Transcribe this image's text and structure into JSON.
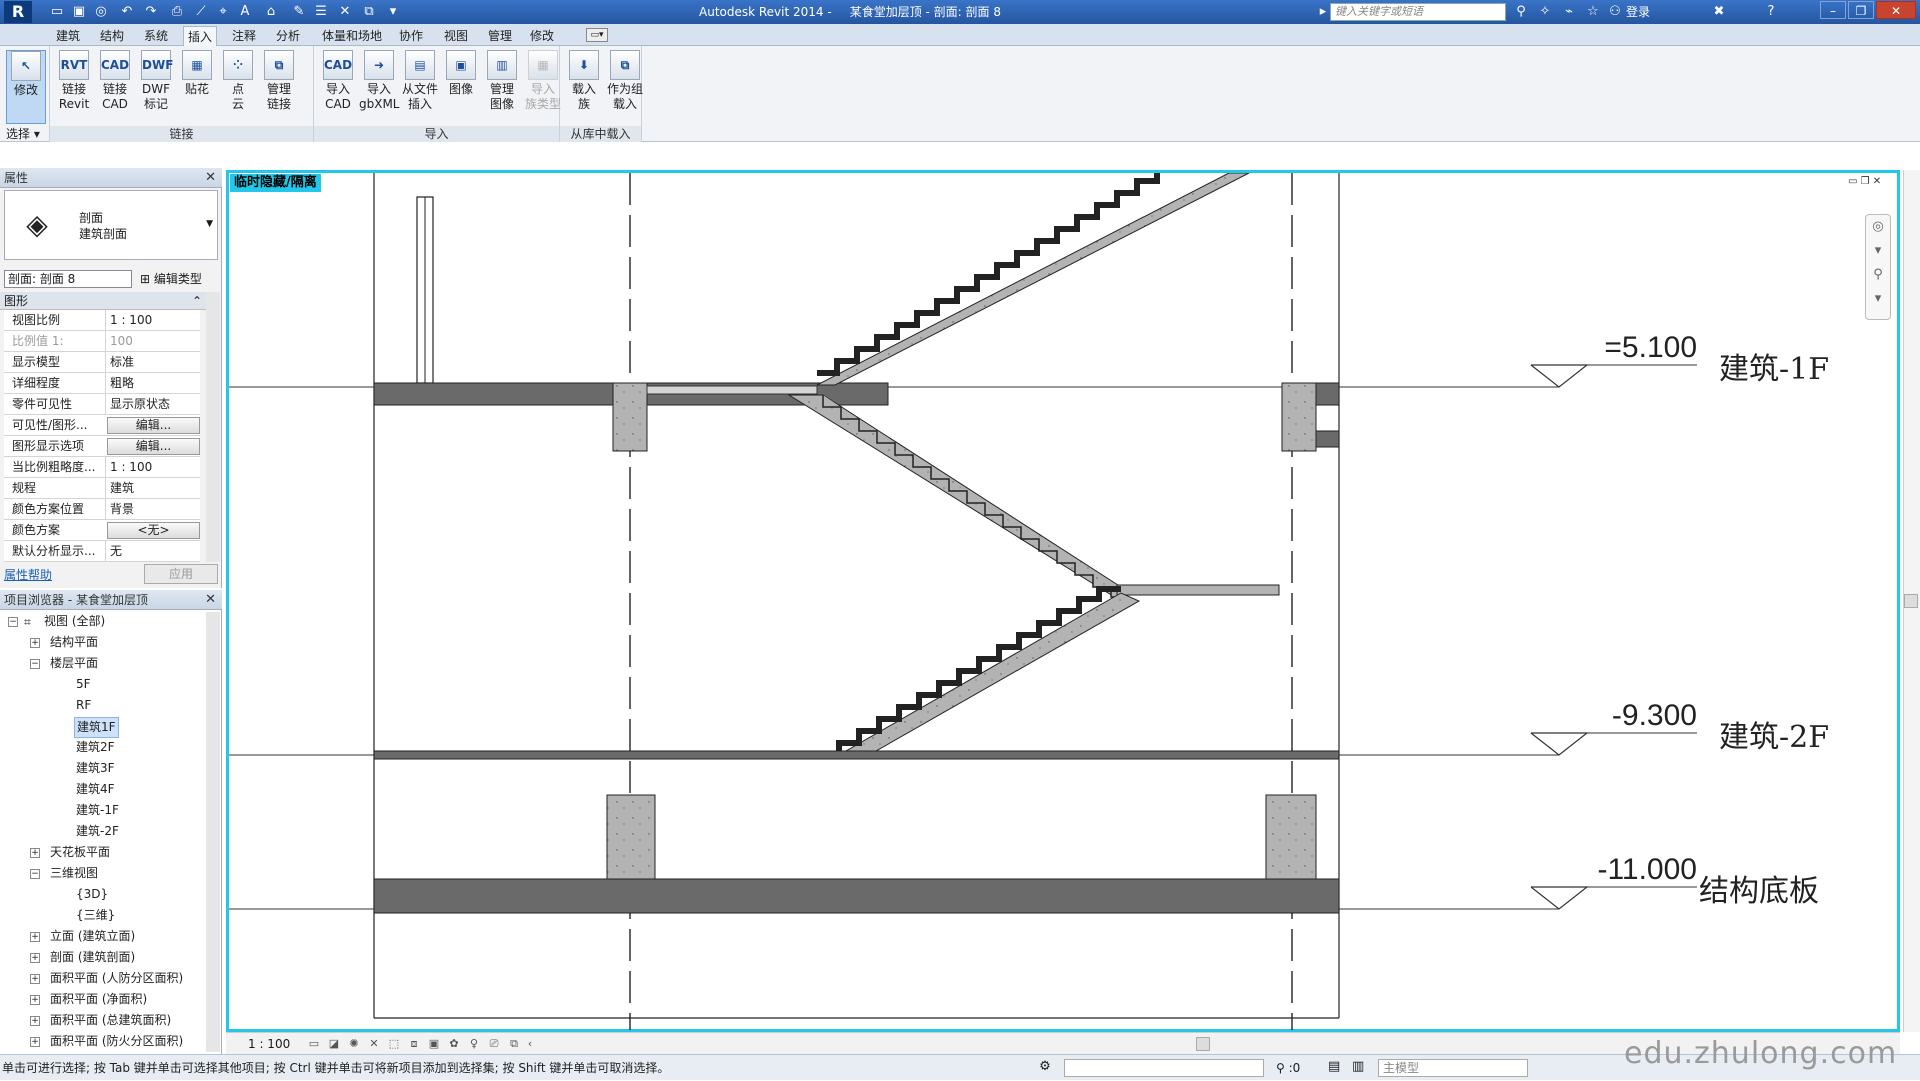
{
  "titlebar": {
    "app_name": "Autodesk Revit 2014 -",
    "doc_title": "某食堂加层顶 - 剖面: 剖面 8",
    "search_placeholder": "键入关键字或短语",
    "login": "登录"
  },
  "menu": {
    "tabs": [
      "建筑",
      "结构",
      "系统",
      "插入",
      "注释",
      "分析",
      "体量和场地",
      "协作",
      "视图",
      "管理",
      "修改"
    ],
    "active": "插入"
  },
  "ribbon": {
    "modify": "修改",
    "select": "选择 ▾",
    "groups": [
      {
        "label": "链接",
        "buttons": [
          {
            "label": "链接\nRevit",
            "icon": "RVT"
          },
          {
            "label": "链接\nCAD",
            "icon": "CAD"
          },
          {
            "label": "DWF\n标记",
            "icon": "DWF"
          },
          {
            "label": "贴花",
            "icon": "▦"
          },
          {
            "label": "点\n云",
            "icon": "⁘"
          },
          {
            "label": "管理\n链接",
            "icon": "⧉"
          }
        ]
      },
      {
        "label": "导入",
        "buttons": [
          {
            "label": "导入\nCAD",
            "icon": "CAD"
          },
          {
            "label": "导入\ngbXML",
            "icon": "➜"
          },
          {
            "label": "从文件\n插入",
            "icon": "▤"
          },
          {
            "label": "图像",
            "icon": "▣"
          },
          {
            "label": "管理\n图像",
            "icon": "▥"
          },
          {
            "label": "导入\n族类型",
            "icon": "▦",
            "disabled": true
          }
        ]
      },
      {
        "label": "从库中载入",
        "buttons": [
          {
            "label": "载入\n族",
            "icon": "⬇"
          },
          {
            "label": "作为组\n载入",
            "icon": "⧉"
          }
        ]
      }
    ]
  },
  "properties": {
    "title": "属性",
    "type_family": "剖面",
    "type_name": "建筑剖面",
    "view_select": "剖面: 剖面 8",
    "edit_type": "编辑类型",
    "group": "图形",
    "rows": [
      {
        "name": "视图比例",
        "value": "1 : 100"
      },
      {
        "name": "比例值 1:",
        "value": "100",
        "dim": true
      },
      {
        "name": "显示模型",
        "value": "标准"
      },
      {
        "name": "详细程度",
        "value": "粗略"
      },
      {
        "name": "零件可见性",
        "value": "显示原状态"
      },
      {
        "name": "可见性/图形...",
        "value": "编辑...",
        "button": true
      },
      {
        "name": "图形显示选项",
        "value": "编辑...",
        "button": true
      },
      {
        "name": "当比例粗略度...",
        "value": "1 : 100"
      },
      {
        "name": "规程",
        "value": "建筑"
      },
      {
        "name": "颜色方案位置",
        "value": "背景"
      },
      {
        "name": "颜色方案",
        "value": "<无>",
        "button": true
      },
      {
        "name": "默认分析显示...",
        "value": "无"
      }
    ],
    "help": "属性帮助",
    "apply": "应用"
  },
  "browser": {
    "title": "项目浏览器 - 某食堂加层顶",
    "tree": [
      {
        "label": "视图 (全部)",
        "level": 0,
        "toggle": "−",
        "icon": true
      },
      {
        "label": "结构平面",
        "level": 1,
        "toggle": "+"
      },
      {
        "label": "楼层平面",
        "level": 1,
        "toggle": "−"
      },
      {
        "label": "5F",
        "level": 2
      },
      {
        "label": "RF",
        "level": 2
      },
      {
        "label": "建筑1F",
        "level": 2,
        "selected": true
      },
      {
        "label": "建筑2F",
        "level": 2
      },
      {
        "label": "建筑3F",
        "level": 2
      },
      {
        "label": "建筑4F",
        "level": 2
      },
      {
        "label": "建筑-1F",
        "level": 2
      },
      {
        "label": "建筑-2F",
        "level": 2
      },
      {
        "label": "天花板平面",
        "level": 1,
        "toggle": "+"
      },
      {
        "label": "三维视图",
        "level": 1,
        "toggle": "−"
      },
      {
        "label": "{3D}",
        "level": 2
      },
      {
        "label": "{三维}",
        "level": 2
      },
      {
        "label": "立面 (建筑立面)",
        "level": 1,
        "toggle": "+"
      },
      {
        "label": "剖面 (建筑剖面)",
        "level": 1,
        "toggle": "+"
      },
      {
        "label": "面积平面 (人防分区面积)",
        "level": 1,
        "toggle": "+"
      },
      {
        "label": "面积平面 (净面积)",
        "level": 1,
        "toggle": "+"
      },
      {
        "label": "面积平面 (总建筑面积)",
        "level": 1,
        "toggle": "+"
      },
      {
        "label": "面积平面 (防火分区面积)",
        "level": 1,
        "toggle": "+"
      }
    ]
  },
  "view": {
    "banner": "临时隐藏/隔离",
    "scale": "1 : 100",
    "levels": [
      {
        "elevation": "=5.100",
        "name": "建筑-1F"
      },
      {
        "elevation": "-9.300",
        "name": "建筑-2F"
      },
      {
        "elevation": "-11.000",
        "name": "结构底板"
      }
    ]
  },
  "statusbar": {
    "text": "单击可进行选择; 按 Tab 键并单击可选择其他项目; 按 Ctrl 键并单击可将新项目添加到选择集; 按 Shift 键并单击可取消选择。",
    "filter": ":0",
    "model": "主模型"
  },
  "watermark": "edu.zhulong.com",
  "colors": {
    "accent": "#23c7e9",
    "concrete": "#b3b3b3",
    "slab": "#6a6a6a",
    "titlebar": "#2e66b5"
  }
}
